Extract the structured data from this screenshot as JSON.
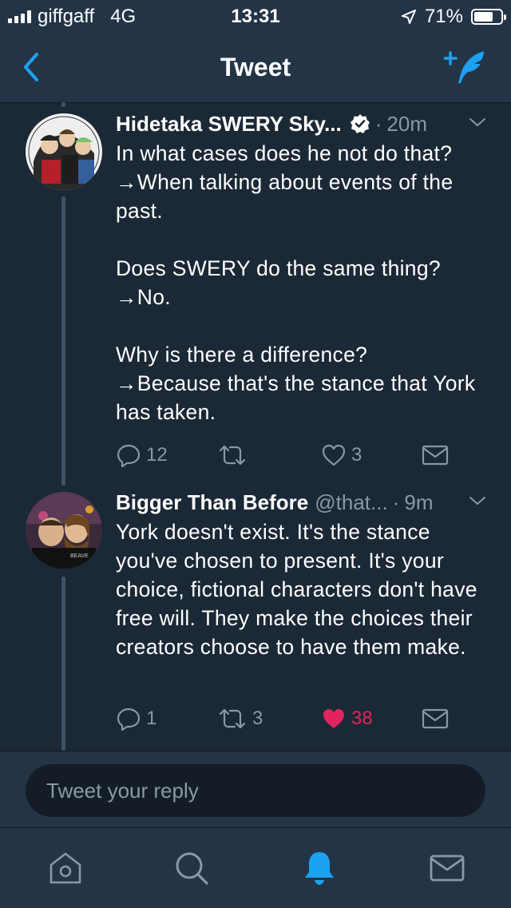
{
  "status_bar": {
    "carrier": "giffgaff",
    "network": "4G",
    "time": "13:31",
    "battery": "71%",
    "battery_level": 0.71
  },
  "nav": {
    "title": "Tweet",
    "back_icon": "chevron-left-icon",
    "compose_icon": "compose-tweet-icon"
  },
  "tweets": [
    {
      "name": "Hidetaka SWERY Sky...",
      "handle": "",
      "verified": true,
      "time": "20m",
      "text": "In what cases does he not do that?\n→When talking about events of the past.\n\nDoes SWERY do the same thing?\n→No.\n\nWhy is there a difference?\n→Because that's the stance that York has taken.",
      "replies": "12",
      "retweets": "",
      "likes": "3",
      "liked": false
    },
    {
      "name": "Bigger Than Before",
      "handle": "@that...",
      "verified": false,
      "time": "9m",
      "text": "York doesn't exist. It's the stance you've chosen to present. It's your choice, fictional characters don't have free will. They make the choices their creators choose to have them make.",
      "replies": "1",
      "retweets": "3",
      "likes": "38",
      "liked": true
    }
  ],
  "reply": {
    "placeholder": "Tweet your reply"
  },
  "tabbar": {
    "items": [
      "home-icon",
      "search-icon",
      "notifications-icon",
      "messages-icon"
    ],
    "active": "notifications-icon"
  },
  "colors": {
    "background": "#1b2836",
    "bar": "#243447",
    "accent": "#1da1f2",
    "secondary_text": "#8899a6",
    "like": "#e0245e"
  }
}
